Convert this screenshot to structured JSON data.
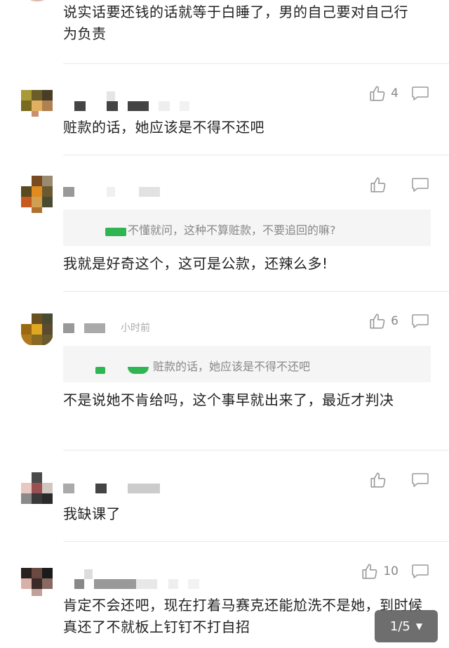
{
  "comments": [
    {
      "id": "c0",
      "text": "说实话要还钱的话就等于白睡了，男的自己要对自己行为负责",
      "likes": "",
      "time": ""
    },
    {
      "id": "c1",
      "text": "赃款的话，她应该是不得不还吧",
      "likes": "4",
      "time": ""
    },
    {
      "id": "c2",
      "quote": "不懂就问，这种不算赃款，不要追回的嘛?",
      "text": "我就是好奇这个，这可是公款，还辣么多!",
      "likes": "",
      "time": ""
    },
    {
      "id": "c3",
      "quote": "赃款的话，她应该是不得不还吧",
      "text": "不是说她不肯给吗，这个事早就出来了，最近才判决",
      "likes": "6",
      "time": "小时前"
    },
    {
      "id": "c4",
      "text": "我缺课了",
      "likes": "",
      "time": ""
    },
    {
      "id": "c5",
      "text": "肯定不会还吧，现在打着马赛克还能尬洗不是她，到时候真还了不就板上钉钉不打自招",
      "likes": "10",
      "time": ""
    }
  ],
  "pager": {
    "label": "1/5",
    "arrow": "▼"
  },
  "icons": {
    "like": "thumbs-up-icon",
    "reply": "comment-bubble-icon"
  },
  "colors": {
    "accent_green": "#2fb552",
    "muted": "#888888",
    "divider": "#e9e9e9"
  }
}
